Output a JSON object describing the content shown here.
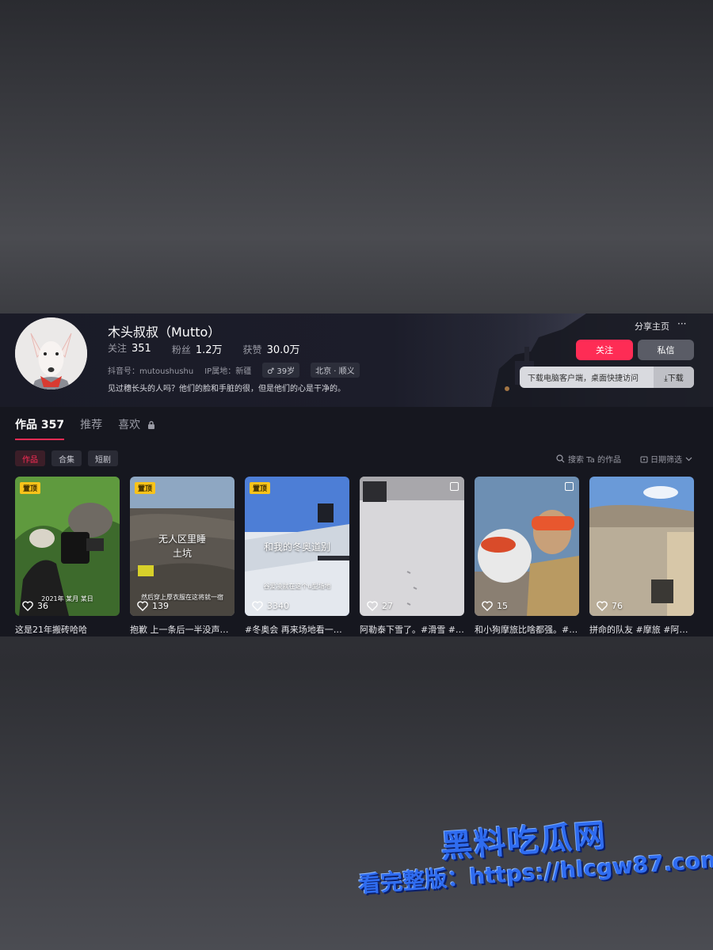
{
  "profile": {
    "name": "木头叔叔（Mutto）",
    "following_label": "关注",
    "following": "351",
    "fans_label": "粉丝",
    "fans": "1.2万",
    "likes_label": "获赞",
    "likes": "30.0万",
    "douyin_id": "抖音号：mutoushushu",
    "ip": "IP属地：新疆",
    "age": "♂ 39岁",
    "location": "北京 · 顺义",
    "bio": "见过穗长头的人吗？他们的脸和手脏的很，但是他们的心是干净的。"
  },
  "actions": {
    "share": "分享主页",
    "more": "···",
    "follow": "关注",
    "message": "私信",
    "download_text": "下载电脑客户端，桌面快捷访问",
    "download_btn": "⤓下载"
  },
  "tabs": [
    {
      "label": "作品 357"
    },
    {
      "label": "推荐"
    },
    {
      "label": "喜欢"
    }
  ],
  "filters": [
    {
      "label": "作品"
    },
    {
      "label": "合集"
    },
    {
      "label": "短剧"
    }
  ],
  "search_works": "搜索 Ta 的作品",
  "date_filter": "日期筛选",
  "videos": [
    {
      "pinned": "置顶",
      "likes": "36",
      "caption": "这是21年搬砖哈哈",
      "overlay": "",
      "small": "2021年 某月 某日"
    },
    {
      "pinned": "置顶",
      "likes": "139",
      "caption": "抱歉 上一条后一半没声…",
      "overlay": "无人区里睡\n土坑",
      "small": "然后穿上厚衣服在这将就一宿"
    },
    {
      "pinned": "置顶",
      "likes": "3340",
      "caption": "#冬奥会 再来场地看一…",
      "overlay": "和我的冬奥道别",
      "small": "谷爱凌就在这个u型场地"
    },
    {
      "pinned": "",
      "likes": "27",
      "caption": "阿勒泰下雪了。#滑雪 #…",
      "overlay": "",
      "small": ""
    },
    {
      "pinned": "",
      "likes": "15",
      "caption": "和小狗摩旅比啥都强。#…",
      "overlay": "",
      "small": ""
    },
    {
      "pinned": "",
      "likes": "76",
      "caption": "拼命的队友 #摩旅 #阿里…",
      "overlay": "",
      "small": ""
    }
  ],
  "watermark": {
    "logo": "黑料吃瓜网",
    "url": "看完整版：https://hlcgw87.com"
  }
}
